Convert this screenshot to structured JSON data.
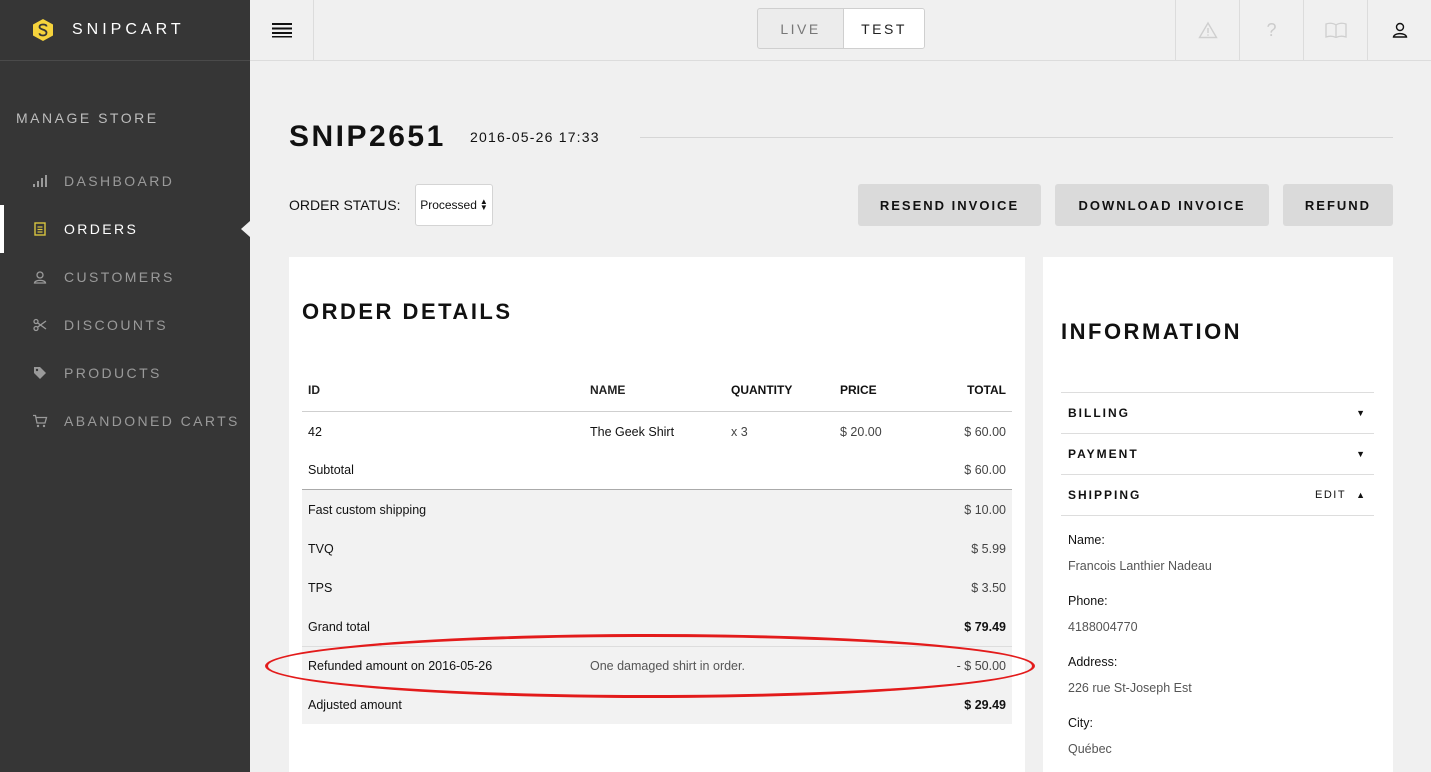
{
  "brand": {
    "name": "SNIPCART"
  },
  "sidebar": {
    "section_title": "MANAGE STORE",
    "items": [
      {
        "label": "DASHBOARD",
        "icon": "bar-chart-icon"
      },
      {
        "label": "ORDERS",
        "icon": "receipt-icon",
        "active": true
      },
      {
        "label": "CUSTOMERS",
        "icon": "user-icon"
      },
      {
        "label": "DISCOUNTS",
        "icon": "scissors-icon"
      },
      {
        "label": "PRODUCTS",
        "icon": "tag-icon"
      },
      {
        "label": "ABANDONED CARTS",
        "icon": "cart-icon"
      }
    ]
  },
  "topbar": {
    "env": {
      "live": "LIVE",
      "test": "TEST",
      "selected": "TEST"
    },
    "icons": [
      "warning-icon",
      "help-icon",
      "book-icon",
      "account-icon"
    ],
    "help_glyph": "?"
  },
  "order": {
    "number": "SNIP2651",
    "date": "2016-05-26 17:33",
    "status_label": "ORDER STATUS:",
    "status_value": "Processed",
    "buttons": {
      "resend": "RESEND INVOICE",
      "download": "DOWNLOAD INVOICE",
      "refund": "REFUND"
    }
  },
  "details": {
    "title": "ORDER DETAILS",
    "columns": {
      "id": "ID",
      "name": "NAME",
      "quantity": "QUANTITY",
      "price": "PRICE",
      "total": "TOTAL"
    },
    "items": [
      {
        "id": "42",
        "name": "The Geek Shirt",
        "quantity": "x 3",
        "price": "$ 20.00",
        "total": "$ 60.00"
      }
    ],
    "subtotal": {
      "label": "Subtotal",
      "value": "$ 60.00"
    },
    "shipping": {
      "label": "Fast custom shipping",
      "value": "$ 10.00"
    },
    "tvq": {
      "label": "TVQ",
      "value": "$ 5.99"
    },
    "tps": {
      "label": "TPS",
      "value": "$ 3.50"
    },
    "grand_total": {
      "label": "Grand total",
      "value": "$ 79.49"
    },
    "refund": {
      "label": "Refunded amount on 2016-05-26",
      "note": "One damaged shirt in order.",
      "value": "- $ 50.00"
    },
    "adjusted": {
      "label": "Adjusted amount",
      "value": "$ 29.49"
    },
    "highlight_color": "#e31b1b"
  },
  "info": {
    "title": "INFORMATION",
    "sections": {
      "billing": "BILLING",
      "payment": "PAYMENT",
      "shipping": "SHIPPING",
      "edit": "EDIT"
    },
    "shipping_fields": {
      "name_label": "Name:",
      "name": "Francois Lanthier Nadeau",
      "phone_label": "Phone:",
      "phone": "4188004770",
      "address_label": "Address:",
      "address": "226 rue St-Joseph Est",
      "city_label": "City:",
      "city": "Québec"
    }
  },
  "colors": {
    "sidebar": "#363636",
    "background": "#f0f0f0",
    "brand_logo": "#f5d33c",
    "accent_icon": "#d9c640"
  }
}
